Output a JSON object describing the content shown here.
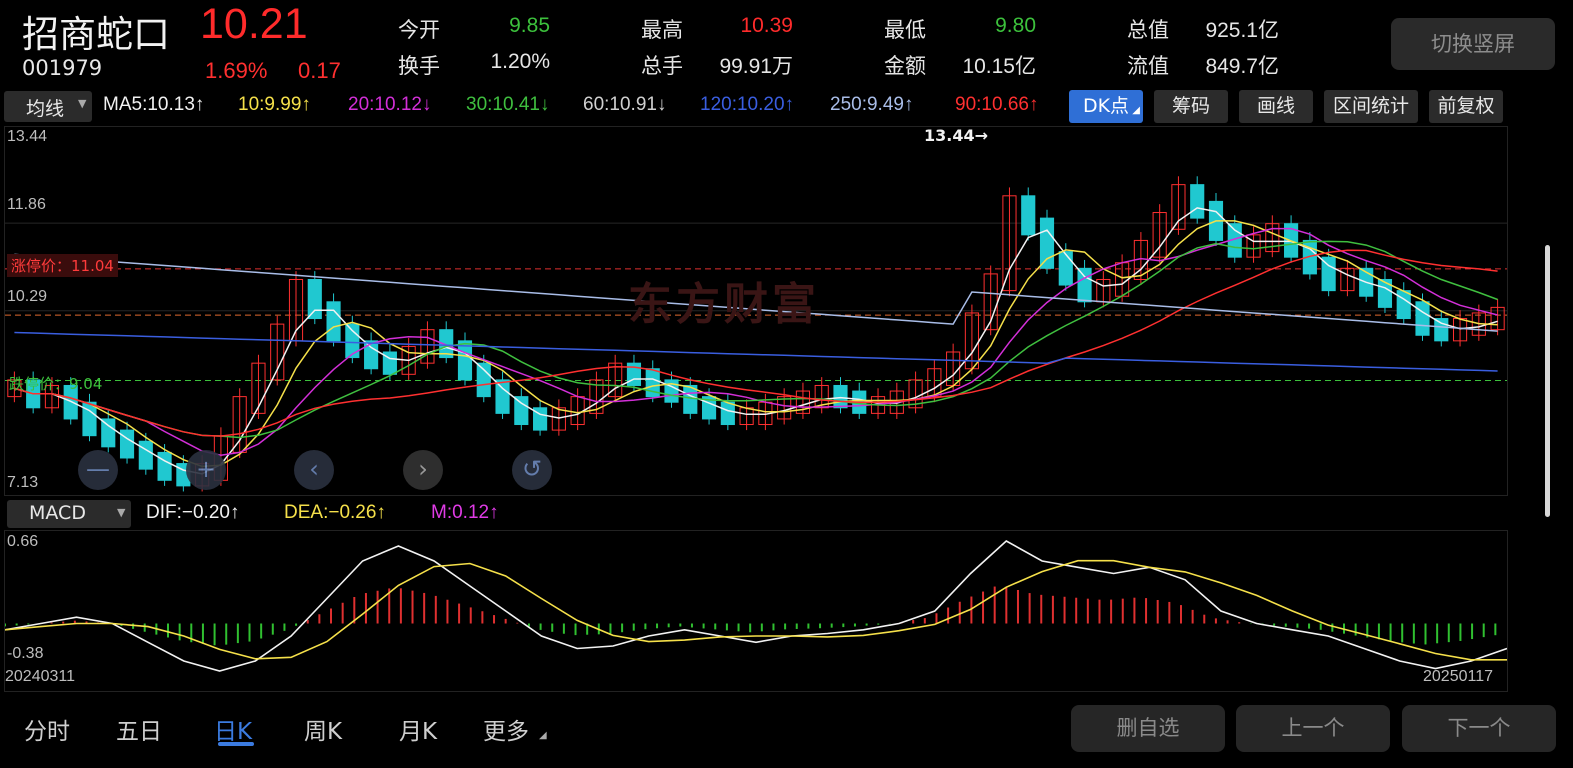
{
  "header": {
    "name": "招商蛇口",
    "code": "001979",
    "price": "10.21",
    "change_pct": "1.69%",
    "change_amt": "0.17",
    "switch_button": "切换竖屏",
    "quotes": [
      {
        "label": "今开",
        "value": "9.85",
        "color": "#3cc13c"
      },
      {
        "label": "换手",
        "value": "1.20%",
        "color": "#e6e6e6"
      },
      {
        "label": "最高",
        "value": "10.39",
        "color": "#ff2b2b"
      },
      {
        "label": "总手",
        "value": "99.91万",
        "color": "#e6e6e6"
      },
      {
        "label": "最低",
        "value": "9.80",
        "color": "#3cc13c"
      },
      {
        "label": "金额",
        "value": "10.15亿",
        "color": "#e6e6e6"
      },
      {
        "label": "总值",
        "value": "925.1亿",
        "color": "#e6e6e6"
      },
      {
        "label": "流值",
        "value": "849.7亿",
        "color": "#e6e6e6"
      }
    ]
  },
  "toolbar": {
    "indicator_select": "均线",
    "ma": [
      {
        "text": "MA5:10.13↑",
        "color": "#f2f2f2"
      },
      {
        "text": "10:9.99↑",
        "color": "#f5e04a"
      },
      {
        "text": "20:10.12↓",
        "color": "#d32fd8"
      },
      {
        "text": "30:10.41↓",
        "color": "#3fbf3f"
      },
      {
        "text": "60:10.91↓",
        "color": "#d0d0d0"
      },
      {
        "text": "120:10.20↑",
        "color": "#3a5ee0"
      },
      {
        "text": "250:9.49↑",
        "color": "#a9bde8"
      },
      {
        "text": "90:10.66↑",
        "color": "#ff3030"
      }
    ],
    "buttons": [
      "DK点",
      "筹码",
      "画线",
      "区间统计",
      "前复权"
    ]
  },
  "kline": {
    "y_labels": [
      "13.44",
      "11.86",
      "10.29",
      "7.13"
    ],
    "limit_up_label": "涨停价：11.04",
    "limit_down_label": "跌停价：9.04",
    "high_marker": "13.44→",
    "low_marker": "7.13",
    "watermark": "东方财富",
    "price_range": [
      7.13,
      13.44
    ]
  },
  "macd": {
    "select": "MACD",
    "dif": "DIF:−0.20↑",
    "dea": "DEA:−0.26↑",
    "m": "M:0.12↑",
    "y_top": "0.66",
    "y_bottom": "-0.38",
    "date_start": "20240311",
    "date_end": "20250117"
  },
  "tabs": [
    "分时",
    "五日",
    "日K",
    "周K",
    "月K",
    "更多"
  ],
  "active_tab": "日K",
  "footer_buttons": [
    "删自选",
    "上一个",
    "下一个"
  ],
  "chart_data": {
    "type": "line",
    "x_start": "20240311",
    "x_end": "20250117",
    "price_axis": [
      7.13,
      13.44
    ],
    "close_approx": [
      8.9,
      8.7,
      8.8,
      8.5,
      8.2,
      8.0,
      7.8,
      7.6,
      7.4,
      7.3,
      7.4,
      7.9,
      8.6,
      9.2,
      9.9,
      10.7,
      10.3,
      9.9,
      9.6,
      9.4,
      9.3,
      9.5,
      9.8,
      9.6,
      9.2,
      8.9,
      8.6,
      8.4,
      8.3,
      8.4,
      8.6,
      8.9,
      9.2,
      9.1,
      8.9,
      8.8,
      8.6,
      8.5,
      8.4,
      8.4,
      8.5,
      8.6,
      8.7,
      8.8,
      8.7,
      8.6,
      8.6,
      8.7,
      8.9,
      9.1,
      9.4,
      10.1,
      10.8,
      12.2,
      11.8,
      11.2,
      10.9,
      10.6,
      10.7,
      11.0,
      11.4,
      11.9,
      12.4,
      12.1,
      11.7,
      11.4,
      11.5,
      11.7,
      11.4,
      11.1,
      10.8,
      10.9,
      10.7,
      10.5,
      10.3,
      10.0,
      9.9,
      10.0,
      10.1,
      10.2
    ],
    "macd_dif_approx": [
      -0.05,
      0.0,
      0.05,
      0.0,
      -0.15,
      -0.3,
      -0.38,
      -0.3,
      -0.1,
      0.2,
      0.5,
      0.62,
      0.5,
      0.3,
      0.1,
      -0.1,
      -0.2,
      -0.18,
      -0.1,
      -0.05,
      -0.1,
      -0.15,
      -0.1,
      -0.08,
      -0.05,
      0.0,
      0.1,
      0.4,
      0.66,
      0.5,
      0.45,
      0.4,
      0.45,
      0.35,
      0.1,
      0.0,
      -0.05,
      -0.1,
      -0.2,
      -0.3,
      -0.36,
      -0.3,
      -0.2
    ]
  }
}
